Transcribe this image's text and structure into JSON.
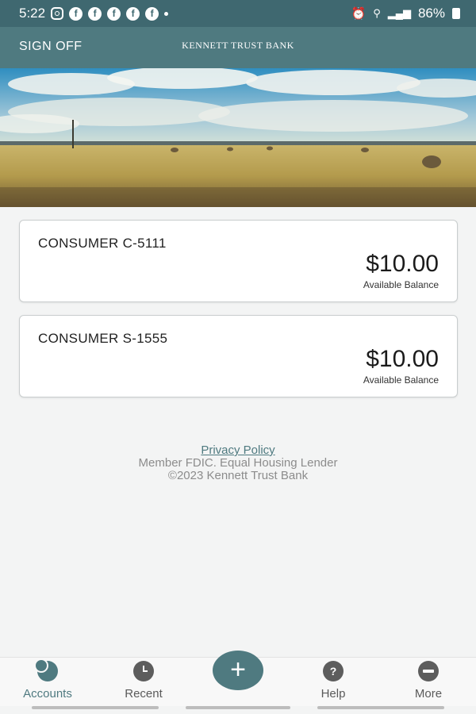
{
  "status_bar": {
    "time": "5:22",
    "battery": "86%"
  },
  "header": {
    "sign_off": "SIGN OFF",
    "bank_name": "KENNETT TRUST BANK"
  },
  "accounts": [
    {
      "name": "CONSUMER C-5111",
      "balance": "$10.00",
      "balance_label": "Available Balance"
    },
    {
      "name": "CONSUMER S-1555",
      "balance": "$10.00",
      "balance_label": "Available Balance"
    }
  ],
  "footer": {
    "privacy_policy": "Privacy Policy",
    "member_text": "Member FDIC. Equal Housing Lender",
    "copyright": "©2023 Kennett Trust Bank"
  },
  "bottom_nav": {
    "items": [
      {
        "label": "Accounts",
        "icon": "accounts-icon",
        "active": true
      },
      {
        "label": "Recent",
        "icon": "clock-icon",
        "active": false
      },
      {
        "label": "Help",
        "icon": "help-icon",
        "active": false
      },
      {
        "label": "More",
        "icon": "more-icon",
        "active": false
      }
    ],
    "fab_symbol": "+"
  },
  "colors": {
    "primary": "#4f7a80",
    "status_bar": "#3f6870",
    "background": "#f3f4f4"
  }
}
